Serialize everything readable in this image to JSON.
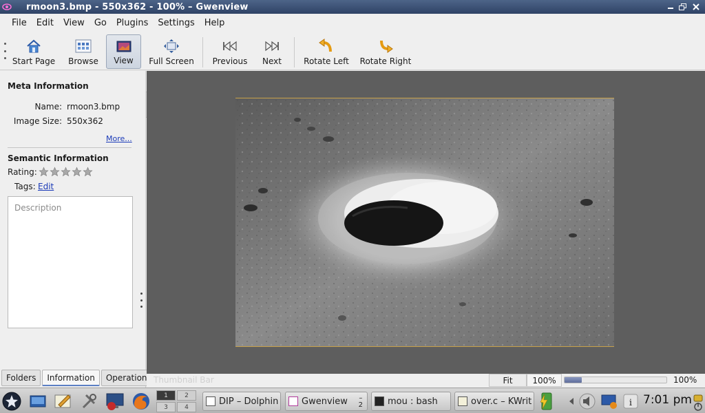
{
  "window": {
    "title": "rmoon3.bmp - 550x362 - 100% – Gwenview"
  },
  "menu": [
    {
      "label": "File"
    },
    {
      "label": "Edit"
    },
    {
      "label": "View"
    },
    {
      "label": "Go"
    },
    {
      "label": "Plugins"
    },
    {
      "label": "Settings"
    },
    {
      "label": "Help"
    }
  ],
  "toolbar": {
    "start_page": "Start Page",
    "browse": "Browse",
    "view": "View",
    "full_screen": "Full Screen",
    "previous": "Previous",
    "next": "Next",
    "rotate_left": "Rotate Left",
    "rotate_right": "Rotate Right"
  },
  "sidebar": {
    "meta_heading": "Meta Information",
    "name_label": "Name:",
    "name_value": "rmoon3.bmp",
    "size_label": "Image Size:",
    "size_value": "550x362",
    "more_link": "More...",
    "semantic_heading": "Semantic Information",
    "rating_label": "Rating:",
    "rating_value": 0,
    "rating_max": 5,
    "tags_label": "Tags:",
    "tags_edit": "Edit",
    "description_placeholder": "Description",
    "tabs": [
      {
        "label": "Folders"
      },
      {
        "label": "Information"
      },
      {
        "label": "Operations"
      }
    ]
  },
  "statusbar": {
    "thumbnail_bar": "Thumbnail Bar",
    "fit": "Fit",
    "zoom_field": "100%",
    "zoom_slider_fraction": 0.17,
    "zoom_label": "100%"
  },
  "taskbar": {
    "pager": [
      "1",
      "2",
      "3",
      "4"
    ],
    "tasks": [
      {
        "label": "DIP – Dolphin"
      },
      {
        "label": "Gwenview",
        "count_top": "–",
        "count_bottom": "2"
      },
      {
        "label": "mou : bash"
      },
      {
        "label": "over.c – KWrit"
      }
    ],
    "clock": "7:01 pm"
  }
}
